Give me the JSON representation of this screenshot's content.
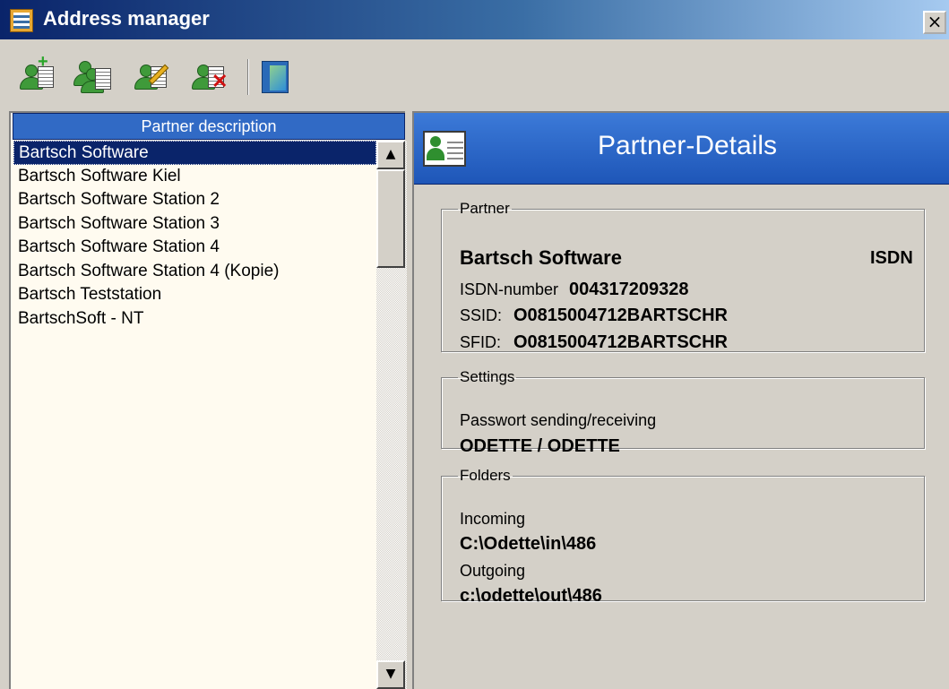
{
  "window": {
    "title": "Address manager",
    "close_glyph": "×"
  },
  "toolbar": {
    "buttons": [
      {
        "name": "add-partner",
        "icon": "person-plus-icon"
      },
      {
        "name": "copy-partner",
        "icon": "person-copy-icon"
      },
      {
        "name": "edit-partner",
        "icon": "person-edit-icon"
      },
      {
        "name": "delete-partner",
        "icon": "person-delete-icon"
      },
      {
        "name": "exit",
        "icon": "door-exit-icon"
      }
    ]
  },
  "partner_list": {
    "header": "Partner description",
    "items": [
      "Bartsch Software",
      "Bartsch Software Kiel",
      "Bartsch Software Station 2",
      "Bartsch Software Station 3",
      "Bartsch Software Station 4",
      "Bartsch Software Station 4 (Kopie)",
      "Bartsch Teststation",
      "BartschSoft - NT"
    ],
    "selected_index": 0,
    "scroll_up_glyph": "▲",
    "scroll_down_glyph": "▼"
  },
  "details": {
    "title": "Partner-Details",
    "partner": {
      "legend": "Partner",
      "name": "Bartsch Software",
      "type": "ISDN",
      "isdn_label": "ISDN-number",
      "isdn_value": "004317209328",
      "ssid_label": "SSID:",
      "ssid_value": "O0815004712BARTSCHR",
      "sfid_label": "SFID:",
      "sfid_value": "O0815004712BARTSCHR"
    },
    "settings": {
      "legend": "Settings",
      "password_label": "Passwort sending/receiving",
      "password_value": "ODETTE / ODETTE"
    },
    "folders": {
      "legend": "Folders",
      "incoming_label": "Incoming",
      "incoming_value": "C:\\Odette\\in\\486",
      "outgoing_label": "Outgoing",
      "outgoing_value": "c:\\odette\\out\\486"
    }
  },
  "colors": {
    "title_bar_start": "#0a246a",
    "title_bar_end": "#a6caf0",
    "selection": "#0a246a",
    "list_background": "#fffbf0",
    "header_blue": "#316ac5"
  }
}
